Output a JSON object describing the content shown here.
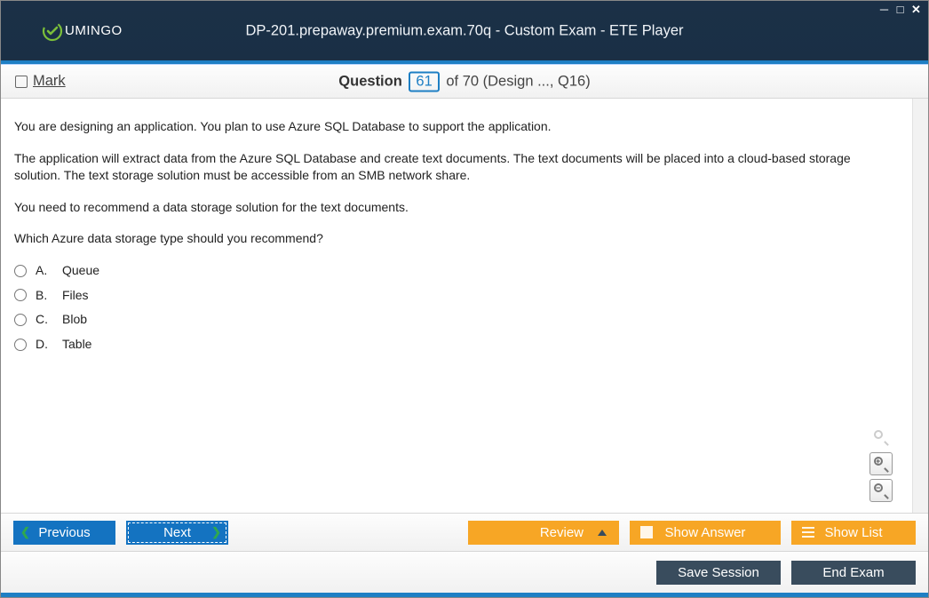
{
  "window": {
    "title": "DP-201.prepaway.premium.exam.70q - Custom Exam - ETE Player",
    "logo_text": "UMINGO"
  },
  "header": {
    "mark_label": "Mark",
    "question_label": "Question",
    "question_number": "61",
    "question_total": "of 70 (Design ..., Q16)"
  },
  "question": {
    "p1": "You are designing an application. You plan to use Azure SQL Database to support the application.",
    "p2": "The application will extract data from the Azure SQL Database and create text documents. The text documents will be placed into a cloud-based storage solution. The text storage solution must be accessible from an SMB network share.",
    "p3": "You need to recommend a data storage solution for the text documents.",
    "p4": "Which Azure data storage type should you recommend?",
    "options": [
      {
        "letter": "A.",
        "text": "Queue"
      },
      {
        "letter": "B.",
        "text": "Files"
      },
      {
        "letter": "C.",
        "text": "Blob"
      },
      {
        "letter": "D.",
        "text": "Table"
      }
    ]
  },
  "nav": {
    "previous": "Previous",
    "next": "Next",
    "review": "Review",
    "show_answer": "Show Answer",
    "show_list": "Show List"
  },
  "bottom": {
    "save_session": "Save Session",
    "end_exam": "End Exam"
  }
}
